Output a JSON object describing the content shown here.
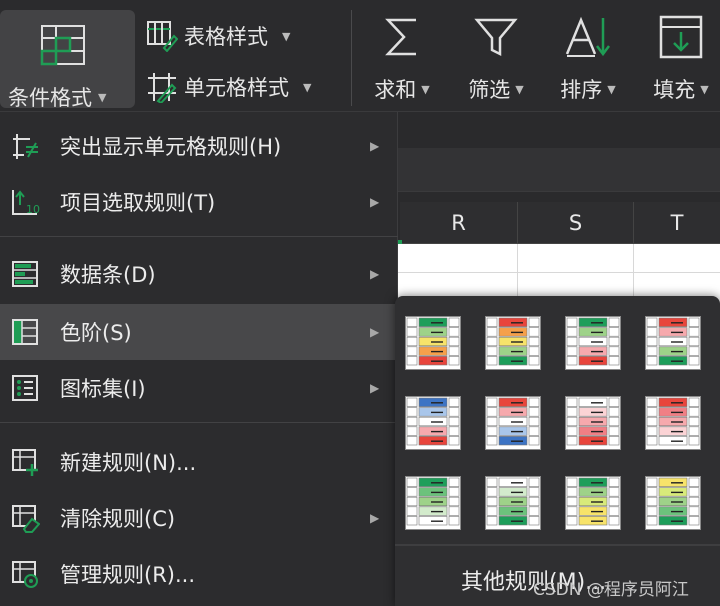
{
  "ribbon": {
    "conditional_format": "条件格式",
    "table_style": "表格样式",
    "cell_style": "单元格样式",
    "sum": "求和",
    "filter": "筛选",
    "sort": "排序",
    "fill": "填充"
  },
  "sheet": {
    "columns": [
      "R",
      "S",
      "T"
    ]
  },
  "menu": {
    "items": [
      {
        "label": "突出显示单元格规则(H)",
        "icon": "highlight-rules-icon",
        "submenu": true
      },
      {
        "label": "项目选取规则(T)",
        "icon": "top-bottom-rules-icon",
        "submenu": true
      },
      {
        "label": "数据条(D)",
        "icon": "data-bars-icon",
        "submenu": true
      },
      {
        "label": "色阶(S)",
        "icon": "color-scales-icon",
        "submenu": true,
        "active": true
      },
      {
        "label": "图标集(I)",
        "icon": "icon-sets-icon",
        "submenu": true
      },
      {
        "label": "新建规则(N)...",
        "icon": "new-rule-icon",
        "submenu": false
      },
      {
        "label": "清除规则(C)",
        "icon": "clear-rules-icon",
        "submenu": true
      },
      {
        "label": "管理规则(R)...",
        "icon": "manage-rules-icon",
        "submenu": false
      }
    ]
  },
  "color_scales": {
    "swatches": [
      [
        "#1e9e5a",
        "#9ed289",
        "#f7e36a",
        "#f5a04b",
        "#e8453c"
      ],
      [
        "#e8453c",
        "#f5a04b",
        "#f7e36a",
        "#9ed289",
        "#1e9e5a"
      ],
      [
        "#1e9e5a",
        "#9ed289",
        "#ffffff",
        "#f6a9ad",
        "#e8453c"
      ],
      [
        "#e8453c",
        "#f6a9ad",
        "#ffffff",
        "#9ed289",
        "#1e9e5a"
      ],
      [
        "#3d74c4",
        "#a9c6ea",
        "#ffffff",
        "#f6a9ad",
        "#e8453c"
      ],
      [
        "#e8453c",
        "#f6a9ad",
        "#ffffff",
        "#a9c6ea",
        "#3d74c4"
      ],
      [
        "#ffffff",
        "#fbd3d5",
        "#f6a9ad",
        "#f07f85",
        "#e8453c"
      ],
      [
        "#e8453c",
        "#f07f85",
        "#f6a9ad",
        "#fbd3d5",
        "#ffffff"
      ],
      [
        "#1e9e5a",
        "#6cc27c",
        "#9ed289",
        "#d3ebcc",
        "#ffffff"
      ],
      [
        "#ffffff",
        "#d3ebcc",
        "#9ed289",
        "#6cc27c",
        "#1e9e5a"
      ],
      [
        "#1e9e5a",
        "#9ed289",
        "#d8ea7a",
        "#f7e36a",
        "#f7e36a"
      ],
      [
        "#f7e36a",
        "#d8ea7a",
        "#9ed289",
        "#6cc27c",
        "#1e9e5a"
      ]
    ],
    "more_rules": "其他规则(M)..."
  },
  "watermark": "CSDN @程序员阿江",
  "colors": {
    "accent_green": "#1f9d55",
    "menu_bg": "#2c2c2e",
    "active_bg": "#48484a"
  }
}
